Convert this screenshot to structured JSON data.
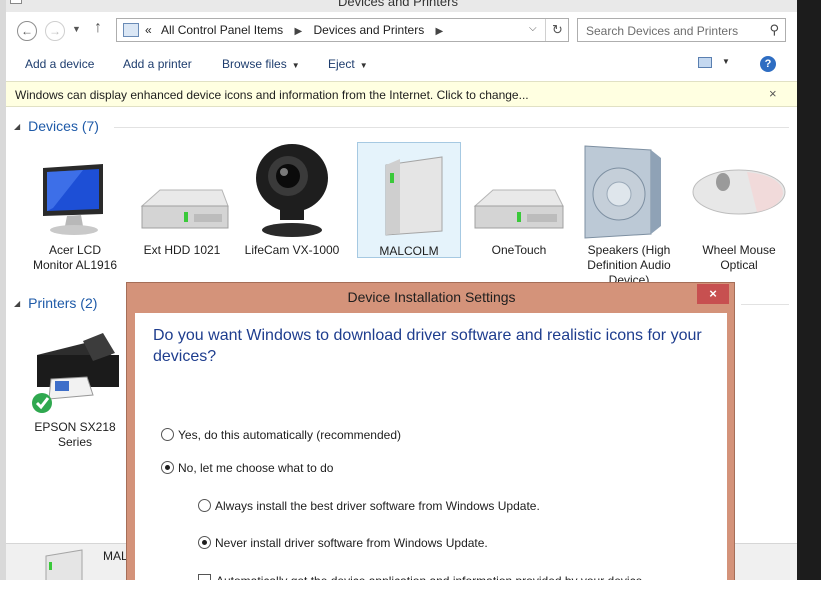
{
  "window": {
    "title": "Devices and Printers"
  },
  "nav": {
    "breadcrumb": [
      "All Control Panel Items",
      "Devices and Printers"
    ],
    "chevron": "«",
    "search_placeholder": "Search Devices and Printers"
  },
  "commands": {
    "add_device": "Add a device",
    "add_printer": "Add a printer",
    "browse_files": "Browse files",
    "eject": "Eject"
  },
  "infobar": {
    "message": "Windows can display enhanced device icons and information from the Internet. Click to change...",
    "close": "×"
  },
  "devices_group": {
    "title": "Devices (7)",
    "items": [
      {
        "line1": "Acer LCD",
        "line2": "Monitor AL1916",
        "icon": "monitor-icon"
      },
      {
        "line1": "Ext HDD 1021",
        "line2": "",
        "icon": "hard-drive-icon"
      },
      {
        "line1": "LifeCam VX-1000",
        "line2": "",
        "icon": "webcam-icon"
      },
      {
        "line1": "MALCOLM",
        "line2": "",
        "icon": "computer-tower-icon"
      },
      {
        "line1": "OneTouch",
        "line2": "",
        "icon": "hard-drive-icon"
      },
      {
        "line1": "Speakers (High",
        "line2": "Definition Audio",
        "line3": "Device)",
        "icon": "speaker-icon"
      },
      {
        "line1": "Wheel Mouse",
        "line2": "Optical",
        "icon": "mouse-icon"
      }
    ]
  },
  "printers_group": {
    "title": "Printers (2)",
    "items": [
      {
        "line1": "EPSON SX218",
        "line2": "Series",
        "icon": "printer-icon"
      }
    ]
  },
  "dialog": {
    "title": "Device Installation Settings",
    "close": "×",
    "question": "Do you want Windows to download driver software and realistic icons for your devices?",
    "opt_yes": "Yes, do this automatically (recommended)",
    "opt_no": "No, let me choose what to do",
    "sub_always": "Always install the best driver software from Windows Update.",
    "sub_never": "Never install driver software from Windows Update.",
    "chk_auto": "Automatically get the device application and information provided by your device manufacturer."
  },
  "details": {
    "name": "MAL"
  },
  "colors": {
    "accent": "#1e5aa8",
    "dialog_frame": "#d4937a",
    "infobar": "#ffffe1",
    "close_red": "#c75050"
  }
}
